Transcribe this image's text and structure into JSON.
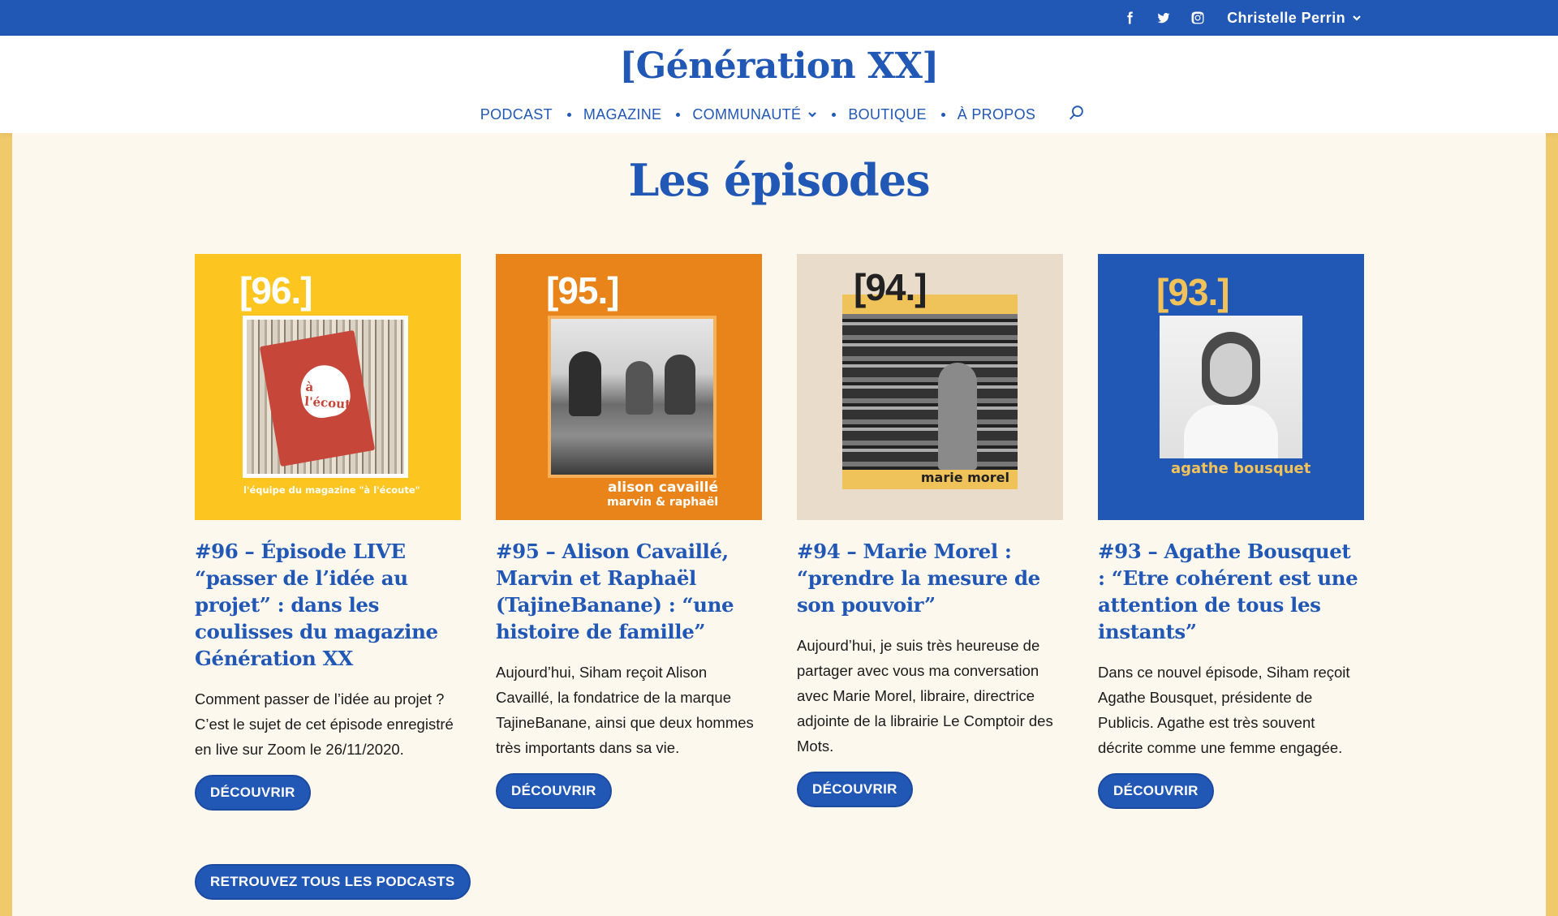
{
  "topbar": {
    "social": [
      "facebook-icon",
      "twitter-icon",
      "instagram-icon"
    ],
    "user_name": "Christelle Perrin"
  },
  "header": {
    "logo": "[Génération XX]",
    "nav": [
      {
        "label": "PODCAST",
        "has_dropdown": false
      },
      {
        "label": "MAGAZINE",
        "has_dropdown": false
      },
      {
        "label": "COMMUNAUTÉ",
        "has_dropdown": true
      },
      {
        "label": "BOUTIQUE",
        "has_dropdown": false
      },
      {
        "label": "À PROPOS",
        "has_dropdown": false
      }
    ]
  },
  "colors": {
    "brand_blue": "#2157b5",
    "side_yellow": "#f0c96b",
    "page_bg": "#fdf8ee"
  },
  "section": {
    "title": "Les épisodes"
  },
  "episodes": [
    {
      "number": "[96.]",
      "cover_bg": "#fcc520",
      "cover_caption": "l'équipe du magazine \"à l'écoute\"",
      "cover_image_text": "à l'écoute",
      "title": "#96 – Épisode LIVE “passer de l’idée au projet” : dans les coulisses du magazine Génération XX",
      "excerpt": "Comment passer de l’idée au projet ? C’est le sujet de cet épisode enregistré en live sur Zoom le 26/11/2020.",
      "button": "DÉCOUVRIR"
    },
    {
      "number": "[95.]",
      "cover_bg": "#e8841a",
      "cover_caption": "alison cavaillé",
      "cover_caption_2": "marvin & raphaël",
      "title": "#95 – Alison Cavaillé, Marvin et Raphaël (TajineBanane) : “une histoire de famille”",
      "excerpt": "Aujourd’hui, Siham reçoit Alison Cavaillé, la fondatrice de la marque TajineBanane, ainsi que deux hommes très importants dans sa vie.",
      "button": "DÉCOUVRIR"
    },
    {
      "number": "[94.]",
      "cover_bg": "#e9dccb",
      "cover_caption": "marie morel",
      "title": "#94 – Marie Morel : “prendre la mesure de son pouvoir”",
      "excerpt": "Aujourd’hui, je suis très heureuse de partager avec vous ma conversation avec Marie Morel, libraire, directrice adjointe de la librairie Le Comptoir des Mots.",
      "button": "DÉCOUVRIR"
    },
    {
      "number": "[93.]",
      "cover_bg": "#2157b5",
      "cover_caption": "agathe bousquet",
      "title": "#93 – Agathe Bousquet : “Etre cohérent est une attention de tous les instants”",
      "excerpt": "Dans ce nouvel épisode, Siham reçoit Agathe Bousquet, présidente de Publicis. Agathe est très souvent décrite comme une femme engagée.",
      "button": "DÉCOUVRIR"
    }
  ],
  "all_podcasts_button": "RETROUVEZ TOUS LES PODCASTS"
}
